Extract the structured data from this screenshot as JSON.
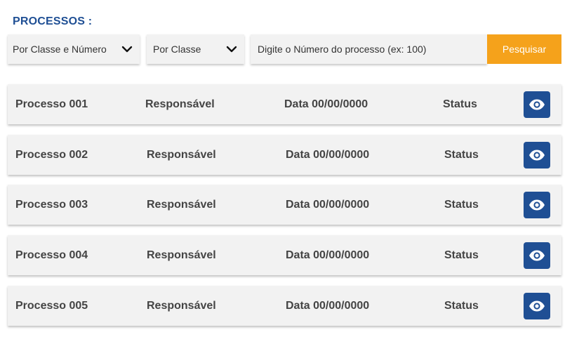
{
  "header": {
    "title": "PROCESSOS :"
  },
  "filters": {
    "select_class_number": {
      "value": "Por Classe e Número",
      "icon": "chevron-down-icon"
    },
    "select_class": {
      "value": "Por Classe",
      "icon": "chevron-down-icon"
    },
    "search": {
      "placeholder": "Digite o Número do processo (ex: 100)",
      "value": ""
    },
    "search_button_label": "Pesquisar"
  },
  "processes": [
    {
      "name": "Processo 001",
      "responsible": "Responsável",
      "date": "Data 00/00/0000",
      "status": "Status",
      "action_icon": "eye-icon"
    },
    {
      "name": "Processo 002",
      "responsible": "Responsável",
      "date": "Data 00/00/0000",
      "status": "Status",
      "action_icon": "eye-icon"
    },
    {
      "name": "Processo 003",
      "responsible": "Responsável",
      "date": "Data 00/00/0000",
      "status": "Status",
      "action_icon": "eye-icon"
    },
    {
      "name": "Processo 004",
      "responsible": "Responsável",
      "date": "Data 00/00/0000",
      "status": "Status",
      "action_icon": "eye-icon"
    },
    {
      "name": "Processo 005",
      "responsible": "Responsável",
      "date": "Data 00/00/0000",
      "status": "Status",
      "action_icon": "eye-icon"
    }
  ],
  "colors": {
    "title": "#1f4f94",
    "accent": "#f5a21b",
    "view_button": "#1f4f94",
    "row_background": "#f2f2f2"
  }
}
